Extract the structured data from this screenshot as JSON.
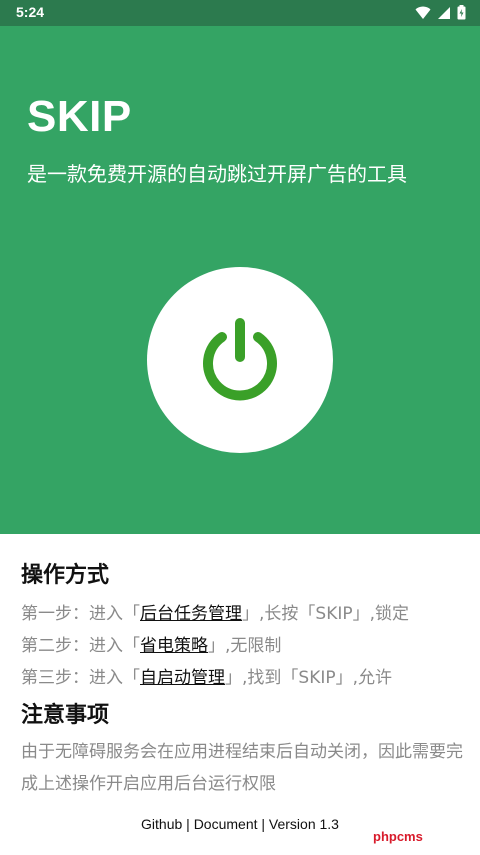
{
  "status": {
    "time": "5:24"
  },
  "hero": {
    "title": "SKIP",
    "subtitle": "是一款免费开源的自动跳过开屏广告的工具",
    "accent_color": "#34a464",
    "power_icon": "power-icon"
  },
  "usage": {
    "title": "操作方式",
    "steps": [
      {
        "prefix": "第一步：进入「",
        "link": "后台任务管理",
        "suffix": "」,长按「SKIP」,锁定"
      },
      {
        "prefix": "第二步：进入「",
        "link": "省电策略",
        "suffix": "」,无限制"
      },
      {
        "prefix": "第三步：进入「",
        "link": "自启动管理",
        "suffix": "」,找到「SKIP」,允许"
      }
    ]
  },
  "notes": {
    "title": "注意事项",
    "text": "由于无障碍服务会在应用进程结束后自动关闭，因此需要完成上述操作开启应用后台运行权限"
  },
  "footer": {
    "github": "Github",
    "document": "Document",
    "version": "Version 1.3",
    "separator": " | "
  },
  "watermark": "phpcms"
}
